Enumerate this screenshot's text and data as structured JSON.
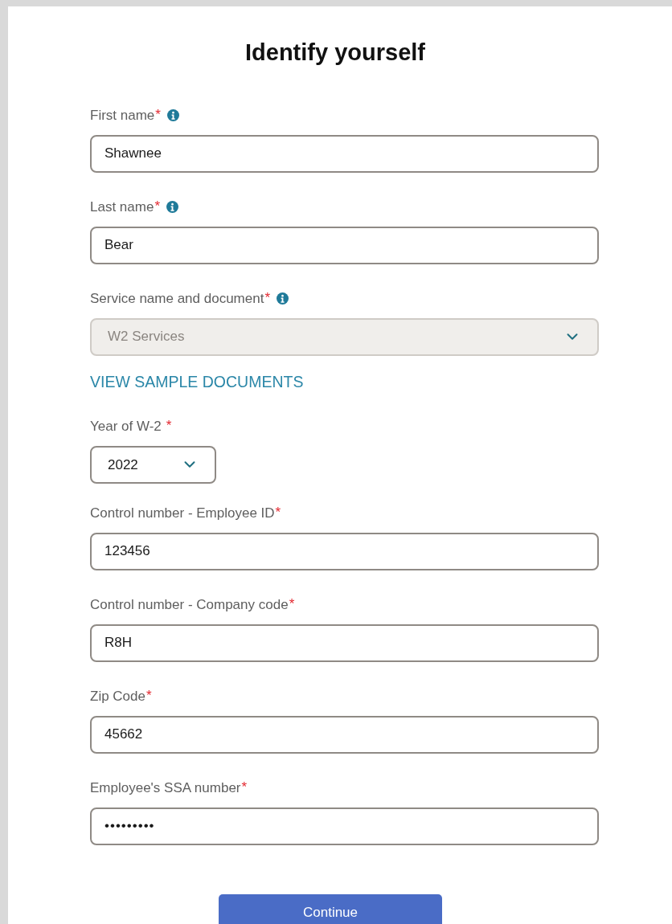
{
  "title": "Identify yourself",
  "fields": [
    {
      "kind": "text",
      "label": "First name",
      "mark": "*",
      "info": true,
      "value": "Shawnee"
    },
    {
      "kind": "text",
      "label": "Last name",
      "mark": "*",
      "info": true,
      "value": "Bear"
    },
    {
      "kind": "select",
      "label": "Service name and document",
      "mark": "*",
      "info": true,
      "value": "W2 Services",
      "disabled": true
    },
    {
      "kind": "link",
      "label": "VIEW SAMPLE DOCUMENTS"
    },
    {
      "kind": "small-select",
      "label": "Year of W-2",
      "mark": "*",
      "info": false,
      "value": "2022",
      "disabled": false
    },
    {
      "kind": "text",
      "label": "Control number - Employee ID",
      "mark": "*",
      "info": false,
      "value": "123456"
    },
    {
      "kind": "text",
      "label": "Control number - Company code",
      "mark": "*",
      "info": false,
      "value": "R8H"
    },
    {
      "kind": "text",
      "label": "Zip Code",
      "mark": "*",
      "info": false,
      "value": "45662"
    },
    {
      "kind": "password",
      "label": "Employee's SSA number",
      "mark": "*",
      "info": false,
      "value": "•••••••••"
    }
  ],
  "submit": "Continue"
}
